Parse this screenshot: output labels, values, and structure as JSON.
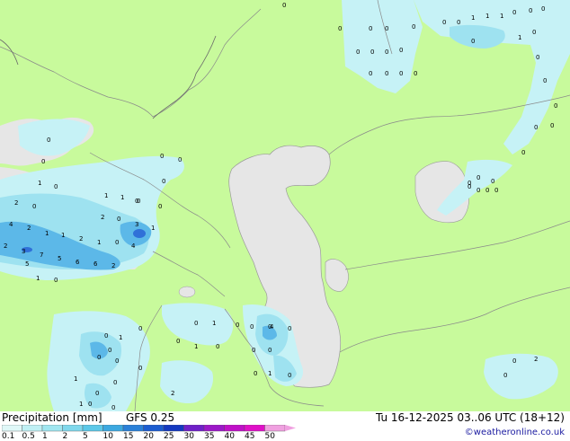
{
  "footer": {
    "product_label": "Precipitation [mm]",
    "model_label": "GFS 0.25",
    "valid_time": "Tu 16-12-2025 03..06 UTC (18+12)",
    "credit": "©weatheronline.co.uk"
  },
  "legend": {
    "ticks": [
      "0.1",
      "0.5",
      "1",
      "2",
      "5",
      "10",
      "15",
      "20",
      "25",
      "30",
      "35",
      "40",
      "45",
      "50"
    ],
    "colors": [
      "#e0f8f8",
      "#c0f0f4",
      "#a0e6f0",
      "#80d8ec",
      "#5cc8e8",
      "#3ca8e0",
      "#2a80d8",
      "#1c5cd0",
      "#1438c0",
      "#7020c8",
      "#9c18c8",
      "#c010c8",
      "#e010c8",
      "#f0a0e0"
    ]
  },
  "map": {
    "land_color": "#c8fa9c",
    "sea_color": "#e6e6e6",
    "precip_colors": {
      "light": "#c6f2f6",
      "medium": "#9ee2f0",
      "heavy": "#5cb8e8",
      "core": "#3070d8"
    },
    "values": [
      {
        "t": "0"
      },
      {
        "t": "0"
      },
      {
        "t": "0"
      },
      {
        "t": "0"
      },
      {
        "t": "0"
      },
      {
        "t": "0"
      },
      {
        "t": "1"
      },
      {
        "t": "1"
      },
      {
        "t": "1"
      },
      {
        "t": "0"
      },
      {
        "t": "0"
      },
      {
        "t": "0"
      },
      {
        "t": "0"
      },
      {
        "t": "0"
      },
      {
        "t": "1"
      },
      {
        "t": "0"
      },
      {
        "t": "0"
      },
      {
        "t": "0"
      },
      {
        "t": "0"
      },
      {
        "t": "0"
      },
      {
        "t": "0"
      },
      {
        "t": "0"
      },
      {
        "t": "0"
      },
      {
        "t": "0"
      },
      {
        "t": "0"
      },
      {
        "t": "0"
      },
      {
        "t": "0"
      },
      {
        "t": "0"
      },
      {
        "t": "0"
      },
      {
        "t": "0"
      },
      {
        "t": "0"
      },
      {
        "t": "0"
      },
      {
        "t": "0"
      },
      {
        "t": "0"
      },
      {
        "t": "1"
      },
      {
        "t": "0"
      },
      {
        "t": "1"
      },
      {
        "t": "1"
      },
      {
        "t": "0"
      },
      {
        "t": "2"
      },
      {
        "t": "0"
      },
      {
        "t": "2"
      },
      {
        "t": "0"
      },
      {
        "t": "3"
      },
      {
        "t": "1"
      },
      {
        "t": "4"
      },
      {
        "t": "2"
      },
      {
        "t": "1"
      },
      {
        "t": "1"
      },
      {
        "t": "2"
      },
      {
        "t": "1"
      },
      {
        "t": "0"
      },
      {
        "t": "4"
      },
      {
        "t": "2"
      },
      {
        "t": "3"
      },
      {
        "t": "7"
      },
      {
        "t": "5"
      },
      {
        "t": "6"
      },
      {
        "t": "6"
      },
      {
        "t": "2"
      },
      {
        "t": "5"
      },
      {
        "t": "1"
      },
      {
        "t": "0"
      },
      {
        "t": "0"
      },
      {
        "t": "0"
      },
      {
        "t": "0"
      },
      {
        "t": "0"
      },
      {
        "t": "0"
      },
      {
        "t": "0"
      },
      {
        "t": "0"
      },
      {
        "t": "1"
      },
      {
        "t": "0"
      },
      {
        "t": "0"
      },
      {
        "t": "0"
      },
      {
        "t": "0"
      },
      {
        "t": "0"
      },
      {
        "t": "0"
      },
      {
        "t": "1"
      },
      {
        "t": "0"
      },
      {
        "t": "0"
      },
      {
        "t": "0"
      },
      {
        "t": "1"
      },
      {
        "t": "0"
      },
      {
        "t": "2"
      },
      {
        "t": "1"
      },
      {
        "t": "0"
      },
      {
        "t": "0"
      },
      {
        "t": "1"
      },
      {
        "t": "0"
      },
      {
        "t": "0"
      },
      {
        "t": "0"
      },
      {
        "t": "0"
      },
      {
        "t": "0"
      },
      {
        "t": "0"
      },
      {
        "t": "4"
      },
      {
        "t": "0"
      },
      {
        "t": "1"
      },
      {
        "t": "0"
      },
      {
        "t": "2"
      },
      {
        "t": "0"
      },
      {
        "t": "0"
      },
      {
        "t": "0"
      },
      {
        "t": "0"
      },
      {
        "t": "0"
      },
      {
        "t": "0"
      }
    ]
  }
}
